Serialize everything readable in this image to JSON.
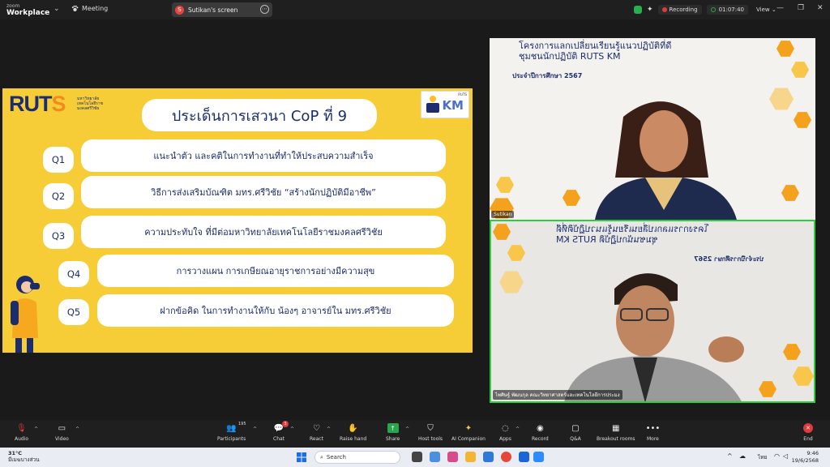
{
  "app": {
    "logo_line1": "zoom",
    "logo_line2": "Workplace",
    "meeting_label": "Meeting",
    "screen_share_label": "Sutikan's screen",
    "screen_share_initial": "S",
    "recording_label": "Recording",
    "timer": "01:07:40",
    "view_label": "View"
  },
  "slide": {
    "logo_main": "RUT",
    "logo_accent": "S",
    "uni_text": "มหาวิทยาลัยเทคโนโลยีราชมงคลศรีวิชัย",
    "km_label": "KM",
    "km_top": "RUTS",
    "title": "ประเด็นการเสวนา CoP ที่ 9",
    "questions": [
      {
        "id": "Q1",
        "text": "แนะนำตัว และคติในการทำงานที่ทำให้ประสบความสำเร็จ"
      },
      {
        "id": "Q2",
        "text": "วิธีการส่งเสริมบัณฑิต มทร.ศรีวิชัย “สร้างนักปฏิบัติมีอาชีพ”"
      },
      {
        "id": "Q3",
        "text": "ความประทับใจ ที่มีต่อมหาวิทยาลัยเทคโนโลยีราชมงคลศรีวิชัย"
      },
      {
        "id": "Q4",
        "text": "การวางแผน การเกษียณอายุราชการอย่างมีความสุข"
      },
      {
        "id": "Q5",
        "text": "ฝากข้อคิด ในการทำงานให้กับ น้องๆ อาจารย์ใน มทร.ศรีวิชัย"
      }
    ]
  },
  "participants": {
    "tile1": {
      "header_line1": "โครงการแลกเปลี่ยนเรียนรู้แนวปฏิบัติที่ดี",
      "header_line2": "ชุมชนนักปฏิบัติ RUTS KM",
      "sub": "ประจำปีการศึกษา 2567",
      "name": "Sutikan"
    },
    "tile2": {
      "header_line1": "โครงการแลกเปลี่ยนเรียนรู้แนวปฏิบัติที่ดี",
      "header_line2": "ชุมชนนักปฏิบัติ RUTS KM",
      "sub": "ประจำปีการศึกษา 2567",
      "name": "ไพศิษฐ์ พัฒนกุล คณะวิทยาศาสตร์และเทคโนโลยีการประมง"
    }
  },
  "toolbar": {
    "audio": "Audio",
    "video": "Video",
    "participants": "Participants",
    "participants_count": "195",
    "chat": "Chat",
    "chat_badge": "3",
    "react": "React",
    "raise_hand": "Raise hand",
    "share": "Share",
    "host_tools": "Host tools",
    "ai_companion": "AI Companion",
    "apps": "Apps",
    "record": "Record",
    "qa": "Q&A",
    "breakout": "Breakout rooms",
    "more": "More",
    "end": "End"
  },
  "taskbar": {
    "temp": "31°C",
    "weather": "มีเมฆบางส่วน",
    "search_placeholder": "Search",
    "lang": "ไทย",
    "time": "9:46",
    "date": "19/6/2568"
  },
  "colors": {
    "slide_bg": "#f7cd37",
    "navy": "#1b2d6e",
    "accent_orange": "#f28a1f",
    "active_speaker": "#2ecc40"
  }
}
